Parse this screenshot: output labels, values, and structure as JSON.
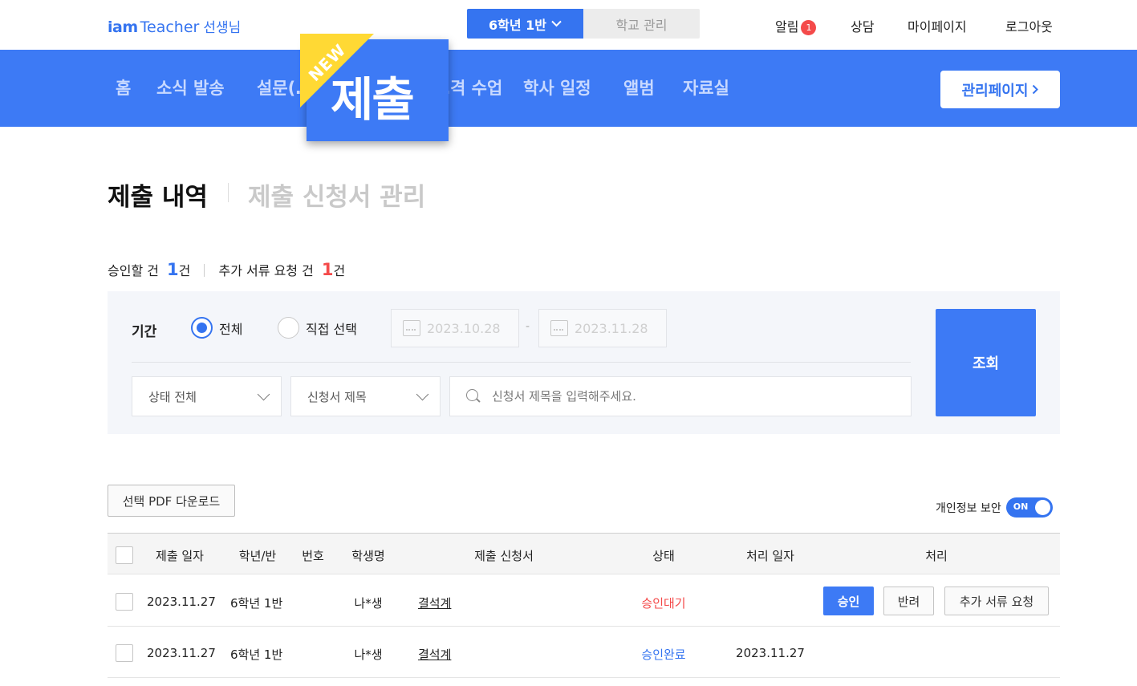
{
  "header": {
    "logo_iam": "iam",
    "logo_teacher": "Teacher",
    "logo_sub": "선생님",
    "class_select": "6학년 1반",
    "school_manage": "학교 관리",
    "alarm_label": "알림",
    "alarm_count": "1",
    "counsel": "상담",
    "mypage": "마이페이지",
    "logout": "로그아웃"
  },
  "nav": {
    "items": [
      "홈",
      "소식 발송",
      "설문(…",
      "…격 수업",
      "학사 일정",
      "앨범",
      "자료실"
    ],
    "highlight_label": "제출",
    "highlight_badge": "NEW",
    "admin_button": "관리페이지"
  },
  "page": {
    "title": "제출 내역",
    "subtitle": "제출 신청서 관리"
  },
  "summary": {
    "approve_label": "승인할 건",
    "approve_count": "1",
    "approve_unit": "건",
    "extra_label": "추가 서류 요청 건",
    "extra_count": "1",
    "extra_unit": "건"
  },
  "filter": {
    "period_label": "기간",
    "radio_all": "전체",
    "radio_custom": "직접 선택",
    "selected_radio": "전체",
    "date_from": "2023.10.28",
    "date_to": "2023.11.28",
    "date_separator": "-",
    "status_select": "상태 전체",
    "form_select": "신청서 제목",
    "search_placeholder": "신청서 제목을 입력해주세요.",
    "search_value": "",
    "query_button": "조회"
  },
  "toolbar": {
    "pdf_button": "선택 PDF 다운로드",
    "privacy_label": "개인정보 보안",
    "privacy_toggle": "ON"
  },
  "table": {
    "headers": [
      "제출 일자",
      "학년/반",
      "번호",
      "학생명",
      "제출 신청서",
      "상태",
      "처리 일자",
      "처리"
    ],
    "rows": [
      {
        "date": "2023.11.27",
        "class": "6학년 1반",
        "number": "",
        "student": "나*생",
        "form": "결석계",
        "status": "승인대기",
        "processed": "",
        "actions": [
          "승인",
          "반려",
          "추가 서류 요청"
        ]
      },
      {
        "date": "2023.11.27",
        "class": "6학년 1반",
        "number": "",
        "student": "나*생",
        "form": "결석계",
        "status": "승인완료",
        "processed": "2023.11.27",
        "actions": []
      }
    ]
  },
  "colors": {
    "brand": "#3574f0",
    "nav_bg": "#3d7af5",
    "new_ribbon": "#ffd934",
    "alert_red": "#f44a4a"
  }
}
